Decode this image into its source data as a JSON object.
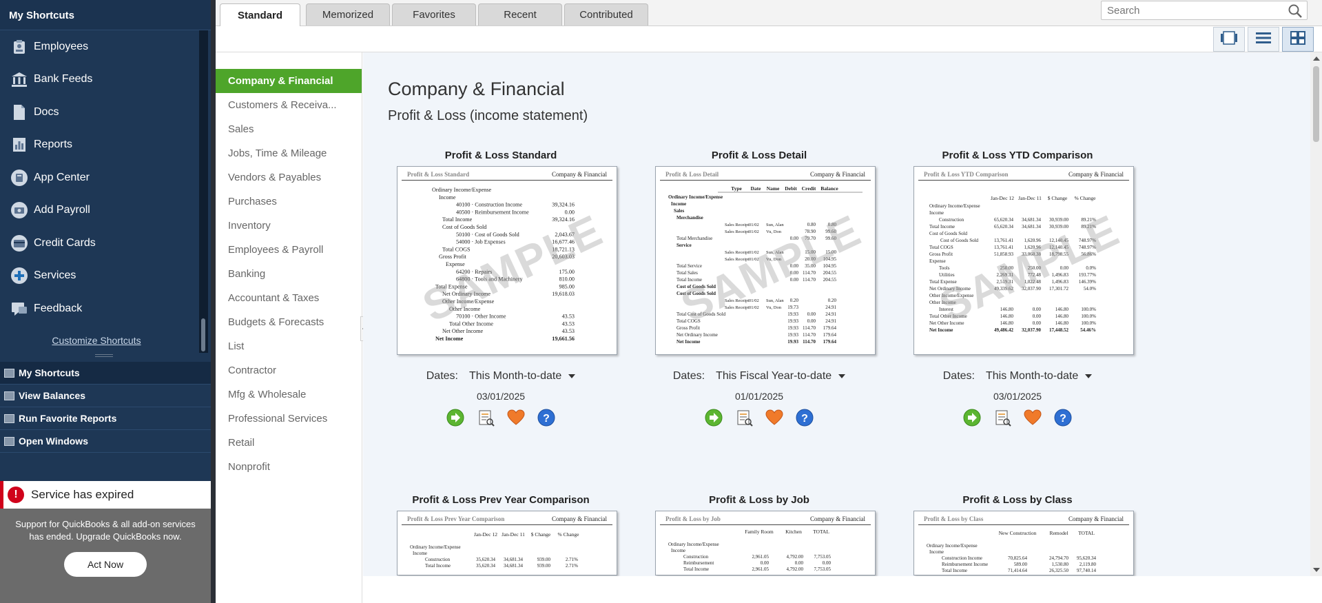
{
  "shortcuts": {
    "header": "My Shortcuts",
    "items": [
      {
        "label": "Employees",
        "icon": "employees-icon"
      },
      {
        "label": "Bank Feeds",
        "icon": "bank-icon"
      },
      {
        "label": "Docs",
        "icon": "docs-icon"
      },
      {
        "label": "Reports",
        "icon": "reports-icon"
      },
      {
        "label": "App Center",
        "icon": "app-center-icon"
      },
      {
        "label": "Add Payroll",
        "icon": "payroll-icon"
      },
      {
        "label": "Credit Cards",
        "icon": "credit-card-icon"
      },
      {
        "label": "Services",
        "icon": "services-icon"
      },
      {
        "label": "Feedback",
        "icon": "feedback-icon"
      }
    ],
    "customize_label": "Customize Shortcuts"
  },
  "bottom_nav": [
    {
      "label": "My Shortcuts"
    },
    {
      "label": "View Balances"
    },
    {
      "label": "Run Favorite Reports"
    },
    {
      "label": "Open Windows"
    }
  ],
  "expired": {
    "title": "Service has expired",
    "message": "Support for QuickBooks & all add-on services has ended. Upgrade QuickBooks now.",
    "button": "Act Now"
  },
  "tabs": [
    "Standard",
    "Memorized",
    "Favorites",
    "Recent",
    "Contributed"
  ],
  "search": {
    "placeholder": "Search"
  },
  "categories": [
    "Company & Financial",
    "Customers & Receiva...",
    "Sales",
    "Jobs, Time & Mileage",
    "Vendors & Payables",
    "Purchases",
    "Inventory",
    "Employees & Payroll",
    "Banking",
    "Accountant & Taxes",
    "Budgets & Forecasts",
    "List",
    "Contractor",
    "Mfg & Wholesale",
    "Professional Services",
    "Retail",
    "Nonprofit"
  ],
  "section": {
    "title": "Company & Financial",
    "subtitle": "Profit & Loss (income statement)"
  },
  "dates_label": "Dates:",
  "watermark": "SAMPLE",
  "reports": [
    {
      "title": "Profit & Loss Standard",
      "thumb_left": "Profit & Loss Standard",
      "thumb_right": "Company & Financial",
      "dates": "This Month-to-date",
      "date": "03/01/2025"
    },
    {
      "title": "Profit & Loss Detail",
      "thumb_left": "Profit & Loss Detail",
      "thumb_right": "Company & Financial",
      "dates": "This Fiscal Year-to-date",
      "date": "01/01/2025"
    },
    {
      "title": "Profit & Loss YTD Comparison",
      "thumb_left": "Profit & Loss YTD Comparison",
      "thumb_right": "Company & Financial",
      "dates": "This Month-to-date",
      "date": "03/01/2025"
    },
    {
      "title": "Profit & Loss Prev Year Comparison",
      "thumb_left": "Profit & Loss Prev Year Comparison",
      "thumb_right": "Company & Financial"
    },
    {
      "title": "Profit & Loss by Job",
      "thumb_left": "Profit & Loss by Job",
      "thumb_right": "Company & Financial"
    },
    {
      "title": "Profit & Loss by Class",
      "thumb_left": "Profit & Loss by Class",
      "thumb_right": "Company & Financial"
    }
  ],
  "thumb_std": [
    [
      "Ordinary Income/Expense",
      ""
    ],
    [
      "Income",
      ""
    ],
    [
      "40100 · Construction Income",
      "39,324.16"
    ],
    [
      "40500 · Reimbursement Income",
      "0.00"
    ],
    [
      "Total Income",
      "39,324.16"
    ],
    [
      "Cost of Goods Sold",
      ""
    ],
    [
      "50100 · Cost of Goods Sold",
      "2,043.67"
    ],
    [
      "54000 · Job Expenses",
      "16,677.46"
    ],
    [
      "Total COGS",
      "18,721.13"
    ],
    [
      "Gross Profit",
      "20,603.03"
    ],
    [
      "Expense",
      ""
    ],
    [
      "64200 · Repairs",
      "175.00"
    ],
    [
      "64800 · Tools and Machinery",
      "810.00"
    ],
    [
      "Total Expense",
      "985.00"
    ],
    [
      "Net Ordinary Income",
      "19,618.03"
    ],
    [
      "Other Income/Expense",
      ""
    ],
    [
      "Other Income",
      ""
    ],
    [
      "70100 · Other Income",
      "43.53"
    ],
    [
      "Total Other Income",
      "43.53"
    ],
    [
      "Net Other Income",
      "43.53"
    ],
    [
      "Net Income",
      "19,661.56"
    ]
  ],
  "thumb_detail": {
    "cols": [
      "Type",
      "Date",
      "Name",
      "Debit",
      "Credit",
      "Balance"
    ],
    "rows": [
      [
        "Ordinary Income/Expense",
        "",
        "",
        "",
        "",
        "",
        ""
      ],
      [
        "Income",
        "",
        "",
        "",
        "",
        "",
        ""
      ],
      [
        "Sales",
        "",
        "",
        "",
        "",
        "",
        ""
      ],
      [
        "Merchandise",
        "",
        "",
        "",
        "",
        "",
        ""
      ],
      [
        "",
        "Sales Receipt",
        "01/02",
        "Sun, Alan",
        "",
        "0.80",
        "0.80"
      ],
      [
        "",
        "Sales Receipt",
        "01/02",
        "Vu, Don",
        "",
        "78.90",
        "99.60"
      ],
      [
        "Total Merchandise",
        "",
        "",
        "",
        "0.00",
        "79.70",
        "99.60"
      ],
      [
        "Service",
        "",
        "",
        "",
        "",
        "",
        ""
      ],
      [
        "",
        "Sales Receipt",
        "01/02",
        "Sun, Alan",
        "",
        "15.00",
        "15.00"
      ],
      [
        "",
        "Sales Receipt",
        "01/02",
        "Vu, Don",
        "",
        "20.00",
        "104.95"
      ],
      [
        "Total Service",
        "",
        "",
        "",
        "0.00",
        "35.00",
        "104.95"
      ],
      [
        "Total Sales",
        "",
        "",
        "",
        "0.00",
        "114.70",
        "204.55"
      ],
      [
        "Total Income",
        "",
        "",
        "",
        "0.00",
        "114.70",
        "204.55"
      ],
      [
        "Cost of Goods Sold",
        "",
        "",
        "",
        "",
        "",
        ""
      ],
      [
        "Cost of Goods Sold",
        "",
        "",
        "",
        "",
        "",
        ""
      ],
      [
        "",
        "Sales Receipt",
        "01/02",
        "Sun, Alan",
        "0.20",
        "",
        "0.20"
      ],
      [
        "",
        "Sales Receipt",
        "01/02",
        "Vu, Don",
        "19.73",
        "",
        "24.91"
      ],
      [
        "Total Cost of Goods Sold",
        "",
        "",
        "",
        "19.93",
        "0.00",
        "24.91"
      ],
      [
        "Total COGS",
        "",
        "",
        "",
        "19.93",
        "0.00",
        "24.91"
      ],
      [
        "Gross Profit",
        "",
        "",
        "",
        "19.93",
        "114.70",
        "179.64"
      ],
      [
        "Net Ordinary Income",
        "",
        "",
        "",
        "19.93",
        "114.70",
        "179.64"
      ],
      [
        "Net Income",
        "",
        "",
        "",
        "19.93",
        "114.70",
        "179.64"
      ]
    ]
  },
  "thumb_ytd": {
    "cols": [
      "Jan-Dec 12",
      "Jan-Dec 11",
      "$ Change",
      "% Change"
    ],
    "rows": [
      [
        "Ordinary Income/Expense",
        "",
        "",
        "",
        ""
      ],
      [
        "Income",
        "",
        "",
        "",
        ""
      ],
      [
        "Construction",
        "65,620.34",
        "34,681.34",
        "30,939.00",
        "89.21%"
      ],
      [
        "Total Income",
        "65,620.34",
        "34,681.34",
        "30,939.00",
        "89.21%"
      ],
      [
        "Cost of Goods Sold",
        "",
        "",
        "",
        ""
      ],
      [
        "Cost of Goods Sold",
        "13,761.41",
        "1,620.96",
        "12,140.45",
        "748.97%"
      ],
      [
        "Total COGS",
        "13,761.41",
        "1,620.96",
        "12,140.45",
        "748.97%"
      ],
      [
        "Gross Profit",
        "51,858.93",
        "33,060.38",
        "18,798.55",
        "56.86%"
      ],
      [
        "Expense",
        "",
        "",
        "",
        ""
      ],
      [
        "Tools",
        "250.00",
        "250.00",
        "0.00",
        "0.0%"
      ],
      [
        "Utilities",
        "2,269.31",
        "772.48",
        "1,496.83",
        "193.77%"
      ],
      [
        "Total Expense",
        "2,519.31",
        "1,022.48",
        "1,496.83",
        "146.39%"
      ],
      [
        "Net Ordinary Income",
        "49,339.62",
        "32,037.90",
        "17,301.72",
        "54.0%"
      ],
      [
        "Other Income/Expense",
        "",
        "",
        "",
        ""
      ],
      [
        "Other Income",
        "",
        "",
        "",
        ""
      ],
      [
        "Interest",
        "146.80",
        "0.00",
        "146.80",
        "100.0%"
      ],
      [
        "Total Other Income",
        "146.80",
        "0.00",
        "146.80",
        "100.0%"
      ],
      [
        "Net Other Income",
        "146.80",
        "0.00",
        "146.80",
        "100.0%"
      ],
      [
        "Net Income",
        "49,486.42",
        "32,037.90",
        "17,448.52",
        "54.46%"
      ]
    ]
  },
  "thumb_prev": {
    "cols": [
      "Jan-Dec 12",
      "Jan-Dec 11",
      "$ Change",
      "% Change"
    ],
    "rows": [
      [
        "Ordinary Income/Expense",
        "",
        "",
        "",
        ""
      ],
      [
        "Income",
        "",
        "",
        "",
        ""
      ],
      [
        "Construction",
        "35,620.34",
        "34,681.34",
        "939.00",
        "2.71%"
      ],
      [
        "Total Income",
        "35,620.34",
        "34,681.34",
        "939.00",
        "2.71%"
      ]
    ]
  },
  "thumb_job": {
    "cols": [
      "Family Room",
      "Kitchen",
      "TOTAL"
    ],
    "rows": [
      [
        "Ordinary Income/Expense",
        "",
        "",
        ""
      ],
      [
        "Income",
        "",
        "",
        ""
      ],
      [
        "Construction",
        "2,961.05",
        "4,792.00",
        "7,753.05"
      ],
      [
        "Reimbursement",
        "0.00",
        "0.00",
        "0.00"
      ],
      [
        "Total Income",
        "2,961.05",
        "4,792.00",
        "7,753.05"
      ]
    ]
  },
  "thumb_class": {
    "cols": [
      "New Construction",
      "Remodel",
      "TOTAL"
    ],
    "rows": [
      [
        "Ordinary Income/Expense",
        "",
        "",
        ""
      ],
      [
        "Income",
        "",
        "",
        ""
      ],
      [
        "Construction Income",
        "70,825.64",
        "24,794.70",
        "95,620.34"
      ],
      [
        "Reimbursement Income",
        "589.00",
        "1,530.80",
        "2,119.80"
      ],
      [
        "Total Income",
        "71,414.64",
        "26,325.50",
        "97,740.14"
      ]
    ]
  },
  "colors": {
    "accent_green": "#4ea52a",
    "sidebar_bg": "#1e3755",
    "alert_red": "#d0021b"
  }
}
